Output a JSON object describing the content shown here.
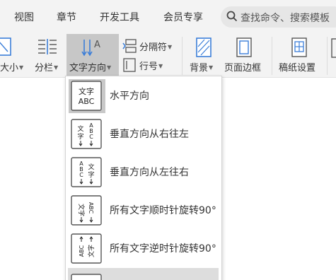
{
  "tabs": [
    "视图",
    "章节",
    "开发工具",
    "会员专享"
  ],
  "search": {
    "placeholder": "查找命令、搜索模板"
  },
  "ribbon": {
    "size_label": "大小",
    "columns_label": "分栏",
    "text_direction_label": "文字方向",
    "separator_label": "分隔符",
    "line_number_label": "行号",
    "background_label": "背景",
    "page_border_label": "页面边框",
    "manuscript_label": "稿纸设置"
  },
  "dropdown": {
    "items": [
      {
        "label": "水平方向",
        "icon": "horizontal-text-icon",
        "selected": true
      },
      {
        "label": "垂直方向从右往左",
        "icon": "vertical-rtl-icon",
        "selected": false
      },
      {
        "label": "垂直方向从左往右",
        "icon": "vertical-ltr-icon",
        "selected": false
      },
      {
        "label": "所有文字顺时针旋转90°",
        "icon": "rotate-cw-icon",
        "selected": false
      },
      {
        "label": "所有文字逆时针旋转90°",
        "icon": "rotate-ccw-icon",
        "selected": false
      }
    ]
  },
  "icon_text": {
    "wen_zi": "文字",
    "abc": "ABC"
  },
  "colors": {
    "accent_blue": "#3b7ed8",
    "active_bg": "#c7c7c7"
  }
}
